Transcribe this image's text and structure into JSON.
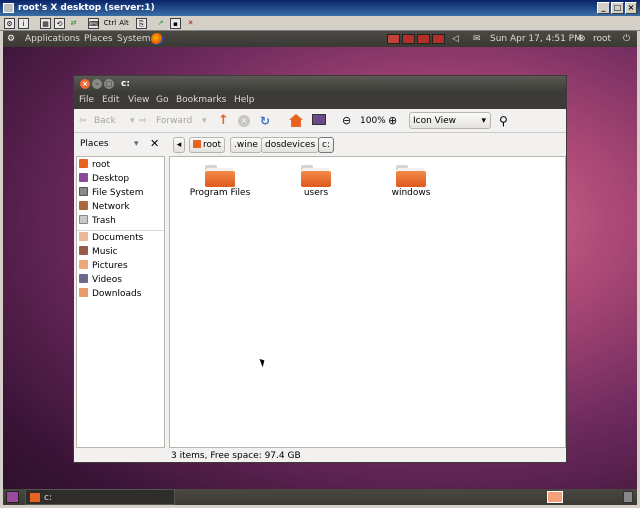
{
  "vnc": {
    "title": "root's X desktop (server:1)",
    "toolbar": {
      "ctrl": "Ctrl",
      "alt": "Alt"
    }
  },
  "top_panel": {
    "applications": "Applications",
    "places": "Places",
    "system": "System",
    "datetime": "Sun Apr 17,  4:51 PM",
    "user": "root"
  },
  "window": {
    "title": "c:",
    "menu": [
      "File",
      "Edit",
      "View",
      "Go",
      "Bookmarks",
      "Help"
    ],
    "toolbar": {
      "back": "Back",
      "forward": "Forward",
      "zoom": "100%",
      "view_mode": "Icon View"
    },
    "path": [
      "root",
      ".wine",
      "dosdevices",
      "c:"
    ],
    "sidebar_header": "Places",
    "sidebar_items": [
      "root",
      "Desktop",
      "File System",
      "Network",
      "Trash",
      "Documents",
      "Music",
      "Pictures",
      "Videos",
      "Downloads"
    ],
    "folders": [
      "Program Files",
      "users",
      "windows"
    ],
    "status": "3 items, Free space: 97.4 GB"
  },
  "bottom_panel": {
    "task": "c:"
  },
  "colors": {
    "accent": "#dd4814",
    "panel": "#3c3b37",
    "folder": "#e8631f"
  }
}
